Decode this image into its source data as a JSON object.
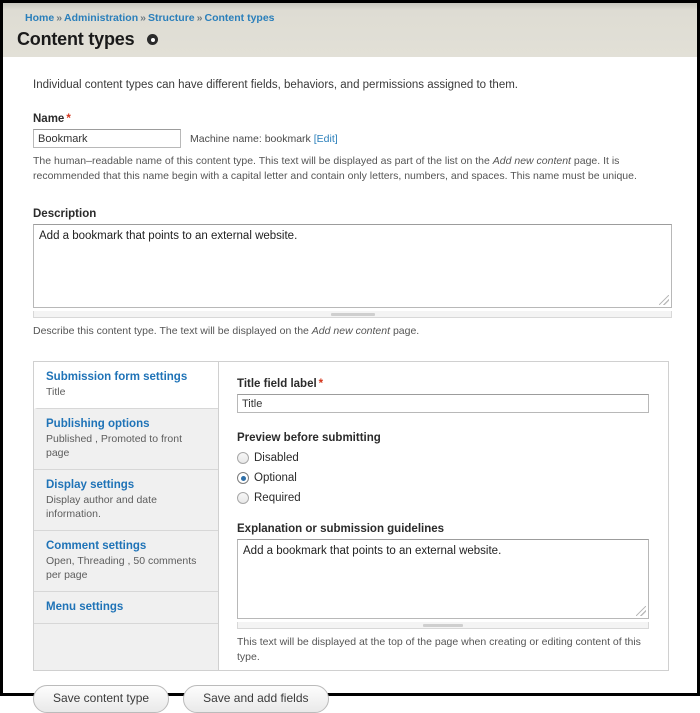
{
  "breadcrumb": {
    "separator": "»",
    "items": [
      {
        "label": "Home"
      },
      {
        "label": "Administration"
      },
      {
        "label": "Structure"
      },
      {
        "label": "Content types"
      }
    ]
  },
  "header": {
    "title": "Content types",
    "contextual_icon": "gear-icon"
  },
  "intro": "Individual content types can have different fields, behaviors, and permissions assigned to them.",
  "name_field": {
    "label": "Name",
    "required_marker": "*",
    "value": "Bookmark",
    "machine_name_prefix": "Machine name: bookmark",
    "machine_name_edit": "[Edit]",
    "help": "The human–readable name of this content type. This text will be displayed as part of the list on the ",
    "help_em": "Add new content",
    "help_tail": " page. It is recommended that this name begin with a capital letter and contain only letters, numbers, and spaces. This name must be unique."
  },
  "description_field": {
    "label": "Description",
    "value": "Add a bookmark that points to an external website.",
    "help": "Describe this content type. The text will be displayed on the ",
    "help_em": "Add new content",
    "help_tail": " page."
  },
  "vertical_tabs": [
    {
      "title": "Submission form settings",
      "summary": "Title",
      "active": true
    },
    {
      "title": "Publishing options",
      "summary": "Published , Promoted to front page",
      "active": false
    },
    {
      "title": "Display settings",
      "summary": "Display author and date information.",
      "active": false
    },
    {
      "title": "Comment settings",
      "summary": "Open, Threading , 50 comments per page",
      "active": false
    },
    {
      "title": "Menu settings",
      "summary": "",
      "active": false
    }
  ],
  "pane": {
    "title_field": {
      "label": "Title field label",
      "required_marker": "*",
      "value": "Title"
    },
    "preview": {
      "label": "Preview before submitting",
      "options": [
        {
          "label": "Disabled",
          "selected": false
        },
        {
          "label": "Optional",
          "selected": true
        },
        {
          "label": "Required",
          "selected": false
        }
      ]
    },
    "explanation": {
      "label": "Explanation or submission guidelines",
      "value": "Add a bookmark that points to an external website.",
      "help": "This text will be displayed at the top of the page when creating or editing content of this type."
    }
  },
  "actions": {
    "save": "Save content type",
    "save_add_fields": "Save and add fields"
  },
  "colors": {
    "link": "#2a7fbb",
    "required": "#d4351c",
    "radio_selected": "#2f6fa8",
    "header_band": "#e2e0d7"
  }
}
